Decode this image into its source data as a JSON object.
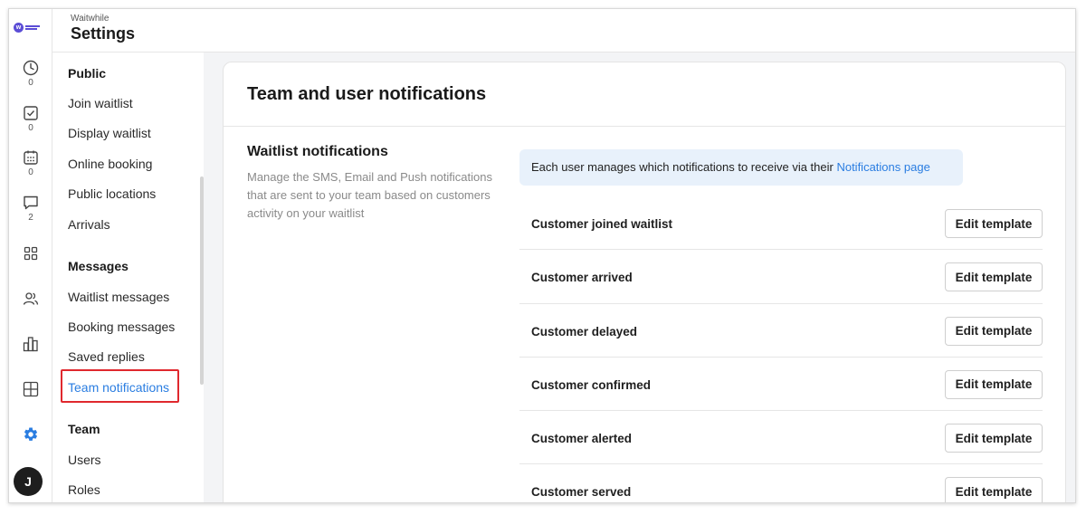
{
  "header": {
    "app_name": "Waitwhile",
    "title": "Settings"
  },
  "rail": {
    "items": [
      {
        "icon": "clock-icon",
        "count": "0"
      },
      {
        "icon": "checkbox-icon",
        "count": "0"
      },
      {
        "icon": "calendar-icon",
        "count": "0"
      },
      {
        "icon": "message-icon",
        "count": "2"
      },
      {
        "icon": "apps-grid-icon"
      },
      {
        "icon": "people-icon"
      },
      {
        "icon": "analytics-icon"
      },
      {
        "icon": "layout-icon"
      },
      {
        "icon": "gear-icon"
      }
    ],
    "avatar_initial": "J",
    "accent_color": "#2a7de1"
  },
  "nav": {
    "public": {
      "heading": "Public",
      "items": [
        "Join waitlist",
        "Display waitlist",
        "Online booking",
        "Public locations",
        "Arrivals"
      ]
    },
    "messages": {
      "heading": "Messages",
      "items": [
        "Waitlist messages",
        "Booking messages",
        "Saved replies",
        "Team notifications"
      ]
    },
    "team": {
      "heading": "Team",
      "items": [
        "Users",
        "Roles"
      ]
    },
    "active_item": "Team notifications"
  },
  "content": {
    "title": "Team and user notifications",
    "section_title": "Waitlist notifications",
    "section_desc": "Manage the SMS, Email and Push notifications that are sent to your team based on customers activity on your waitlist",
    "banner_text": "Each user manages which notifications to receive via their ",
    "banner_link": "Notifications page",
    "button_label": "Edit template",
    "rows": [
      "Customer joined waitlist",
      "Customer arrived",
      "Customer delayed",
      "Customer confirmed",
      "Customer alerted",
      "Customer served"
    ]
  }
}
